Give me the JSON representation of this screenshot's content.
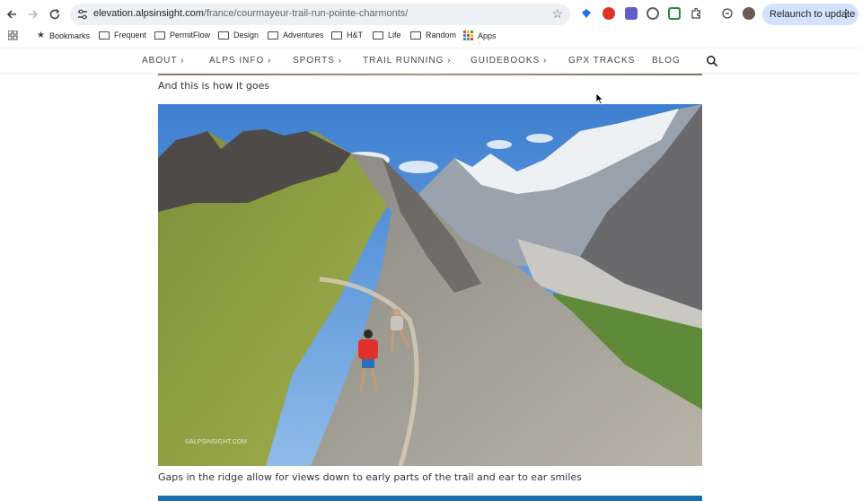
{
  "browser": {
    "url_host": "elevation.alpsinsight.com",
    "url_path": "/france/courmayeur-trail-run-pointe-charmonts/",
    "relaunch_label": "Relaunch to update"
  },
  "bookmarks": {
    "items": [
      "Bookmarks",
      "Frequent",
      "PermitFlow",
      "Design",
      "Adventures",
      "H&T",
      "Life",
      "Random",
      "Apps"
    ]
  },
  "site_nav": {
    "items": [
      {
        "label": "ABOUT",
        "chevron": "›"
      },
      {
        "label": "ALPS INFO",
        "chevron": "›"
      },
      {
        "label": "SPORTS",
        "chevron": "›"
      },
      {
        "label": "TRAIL RUNNING",
        "chevron": "›"
      },
      {
        "label": "GUIDEBOOKS",
        "chevron": "›"
      },
      {
        "label": "GPX TRACKS",
        "chevron": ""
      },
      {
        "label": "BLOG",
        "chevron": ""
      }
    ]
  },
  "article": {
    "caption_above": "And this is how it goes",
    "caption_below": "Gaps in the ridge allow for views down to early parts of the trail and ear to ear smiles",
    "photo_watermark": "©ALPSINSIGHT.COM"
  },
  "colors": {
    "relaunch_bg": "#d3e3fd",
    "omnibox_bg": "#edf0f5",
    "strip_blue": "#1b6fa8"
  }
}
